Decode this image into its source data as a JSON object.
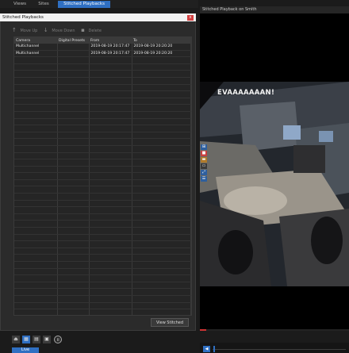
{
  "top_tabs": [
    {
      "label": "Views"
    },
    {
      "label": "Sites"
    },
    {
      "label": "Stitched Playbacks"
    }
  ],
  "panel": {
    "title": "Stitched Playbacks",
    "close_glyph": "x",
    "toolbar": {
      "move_up": "Move Up",
      "move_down": "Move Down",
      "delete": "Delete"
    },
    "table": {
      "headers": [
        "Camera",
        "Digital Presets",
        "From",
        "To"
      ],
      "rows": [
        [
          "Multichannel",
          "",
          "2019-08-19 20:17:47",
          "2019-08-19 20:20:20"
        ],
        [
          "Multichannel",
          "",
          "2019-08-19 20:17:47",
          "2019-08-19 20:20:20"
        ]
      ]
    },
    "view_button": "View Stitched"
  },
  "bottom": {
    "live_tab": "Live"
  },
  "viewer": {
    "title": "Stitched Playback on Smith",
    "video_caption": "EVAAAAAAAN!"
  },
  "colors": {
    "accent": "#2f6fc2",
    "close": "#d24040",
    "background": "#1b1b1b"
  }
}
